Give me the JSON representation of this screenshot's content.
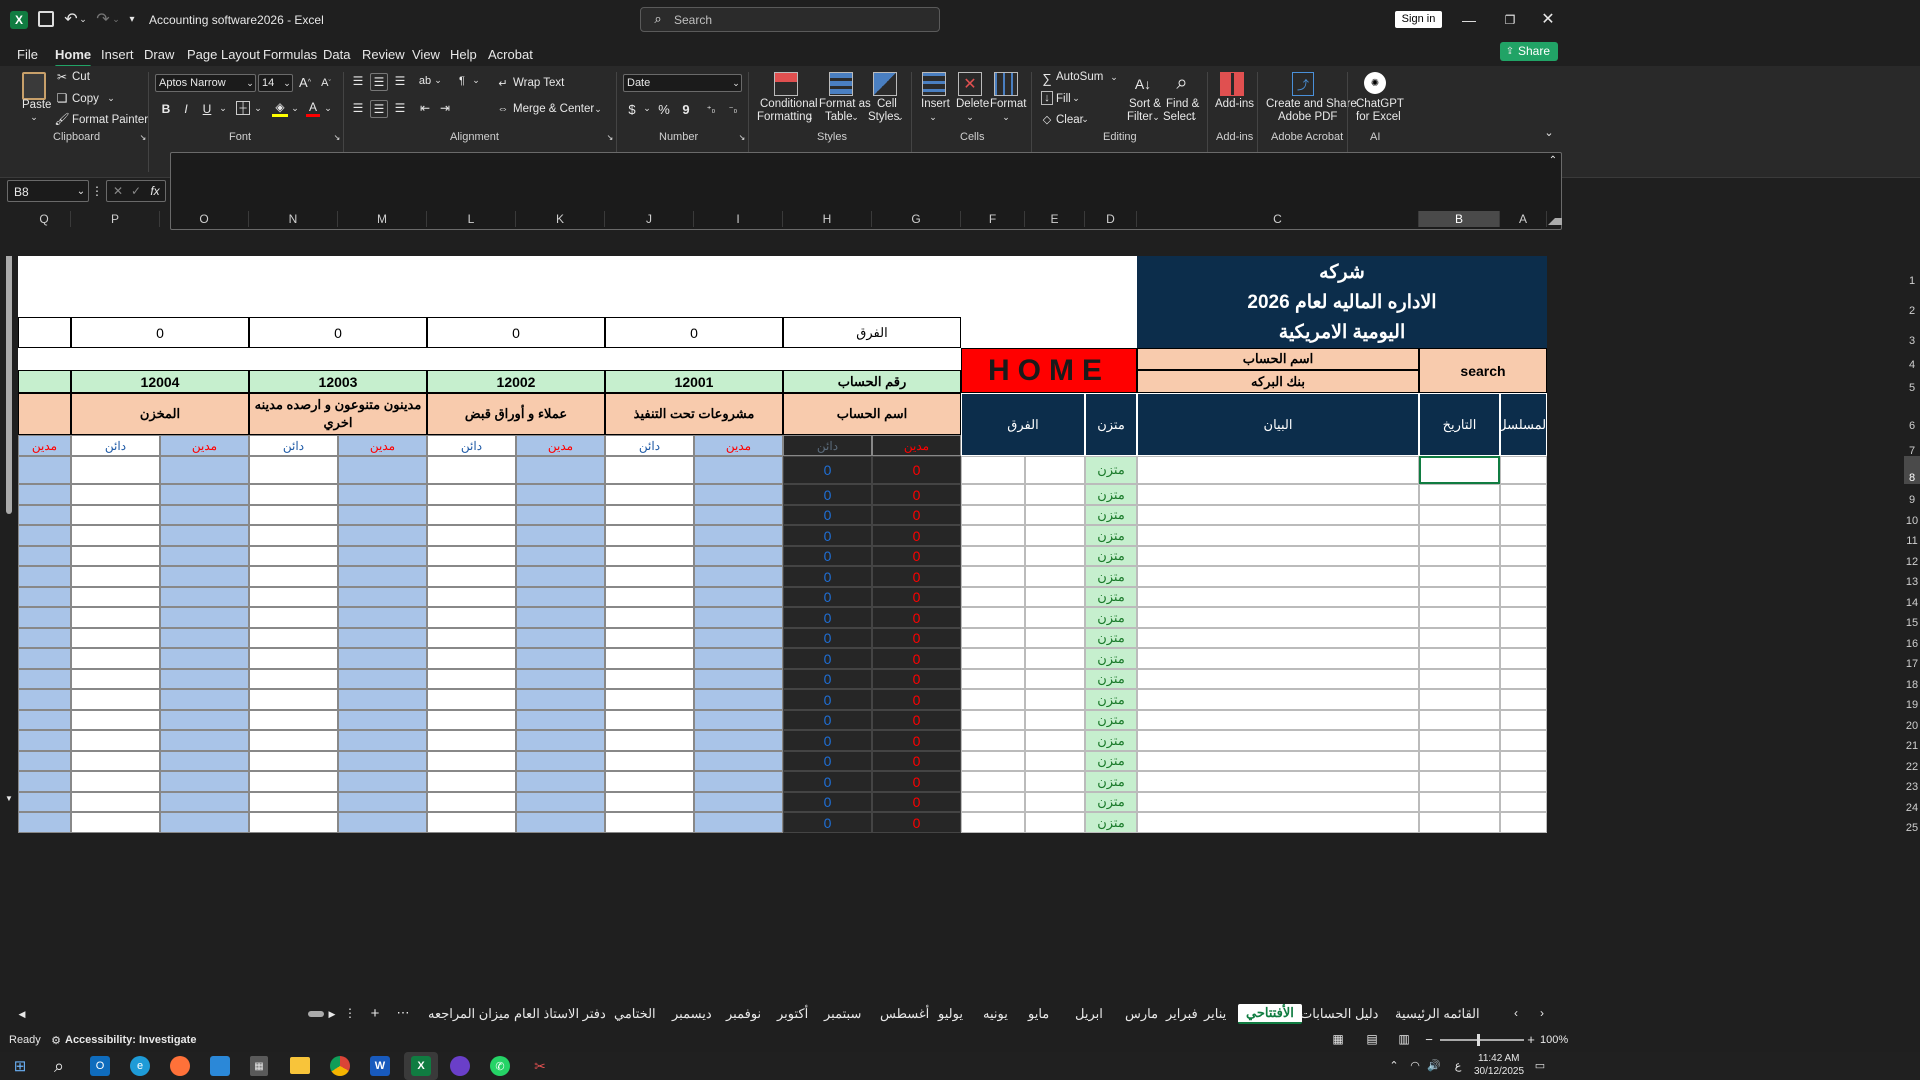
{
  "window": {
    "title": "Accounting software2026  -  Excel",
    "search_placeholder": "Search",
    "sign_in": "Sign in"
  },
  "menu": [
    "File",
    "Home",
    "Insert",
    "Draw",
    "Page Layout",
    "Formulas",
    "Data",
    "Review",
    "View",
    "Help",
    "Acrobat"
  ],
  "share": "Share",
  "ribbon": {
    "clipboard": {
      "paste": "Paste",
      "cut": "Cut",
      "copy": "Copy",
      "format_painter": "Format Painter",
      "group": "Clipboard"
    },
    "font": {
      "name": "Aptos Narrow",
      "size": "14",
      "group": "Font",
      "bold": "B",
      "italic": "I",
      "underline": "U"
    },
    "alignment": {
      "wrap": "Wrap Text",
      "merge": "Merge & Center",
      "group": "Alignment"
    },
    "number": {
      "format": "Date",
      "currency": "$",
      "percent": "%",
      "comma": "9",
      "group": "Number"
    },
    "styles": {
      "conditional": "Conditional",
      "conditional2": "Formatting",
      "format_table": "Format as",
      "format_table2": "Table",
      "cell_styles": "Cell",
      "cell_styles2": "Styles",
      "group": "Styles"
    },
    "cells": {
      "insert": "Insert",
      "delete": "Delete",
      "format": "Format",
      "group": "Cells"
    },
    "editing": {
      "autosum": "AutoSum",
      "fill": "Fill",
      "clear": "Clear",
      "sort": "Sort &",
      "sort2": "Filter",
      "find": "Find &",
      "find2": "Select",
      "group": "Editing"
    },
    "addins": {
      "label": "Add-ins",
      "group": "Add-ins"
    },
    "acrobat": {
      "label": "Create and Share",
      "label2": "Adobe PDF",
      "group": "Adobe Acrobat"
    },
    "ai": {
      "label": "ChatGPT",
      "label2": "for Excel",
      "group": "AI"
    }
  },
  "formula": {
    "name_box": "B8",
    "fx": "fx",
    "value": ""
  },
  "columns": [
    "Q",
    "P",
    "O",
    "N",
    "M",
    "L",
    "K",
    "J",
    "I",
    "H",
    "G",
    "F",
    "E",
    "D",
    "C",
    "B",
    "A"
  ],
  "rows": [
    "1",
    "2",
    "3",
    "4",
    "5",
    "6",
    "7",
    "8",
    "9",
    "10",
    "11",
    "12",
    "13",
    "14",
    "15",
    "16",
    "17",
    "18",
    "19",
    "20",
    "21",
    "22",
    "23",
    "24",
    "25"
  ],
  "sheet": {
    "company": "شركه",
    "subtitle": "الاداره الماليه لعام 2026",
    "journal": "اليومية الامريكية",
    "home": "HOME",
    "account_name_label": "اسم الحساب",
    "account_name_value": "بنك البركه",
    "search": "search",
    "diff_label": "الفرق",
    "diff_values": [
      "0",
      "0",
      "0",
      "0"
    ],
    "account_number_label": "رقم الحساب",
    "account_label": "اسم الحساب",
    "accounts": [
      {
        "number": "12001",
        "name": "مشروعات تحت التنفيذ"
      },
      {
        "number": "12002",
        "name": "عملاء و أوراق قبض"
      },
      {
        "number": "12003",
        "name": "مدينون متنوعون و ارصده مدينه اخري"
      },
      {
        "number": "12004",
        "name": "المخزن"
      }
    ],
    "debit": "مدين",
    "credit": "دائن",
    "headers": {
      "serial": "المسلسل",
      "date": "التاريخ",
      "statement": "البيان",
      "balanced": "متزن",
      "diff": "الفرق"
    },
    "balanced_value": "متزن",
    "zero": "0"
  },
  "tabs": [
    "القائمه الرئيسية",
    "دليل الحسابات",
    "الأفتتاحي",
    "يناير",
    "فبراير",
    "مارس",
    "ابريل",
    "مايو",
    "يونيه",
    "يوليو",
    "أغسطس",
    "سبتمبر",
    "أكتوبر",
    "نوفمبر",
    "ديسمبر",
    "الختامي",
    "دفتر الاستاذ العام",
    "ميزان المراجعه"
  ],
  "status": {
    "ready": "Ready",
    "accessibility": "Accessibility: Investigate",
    "zoom": "100%"
  },
  "clock": {
    "time": "11:42 AM",
    "date": "30/12/2025"
  },
  "colors": {
    "navy": "#0c2d4b",
    "salmon": "#f8cbad",
    "green": "#c6efce",
    "blue": "#a9c4e8",
    "red": "#ff0000",
    "dark": "#262626",
    "excel_green": "#21a366"
  }
}
